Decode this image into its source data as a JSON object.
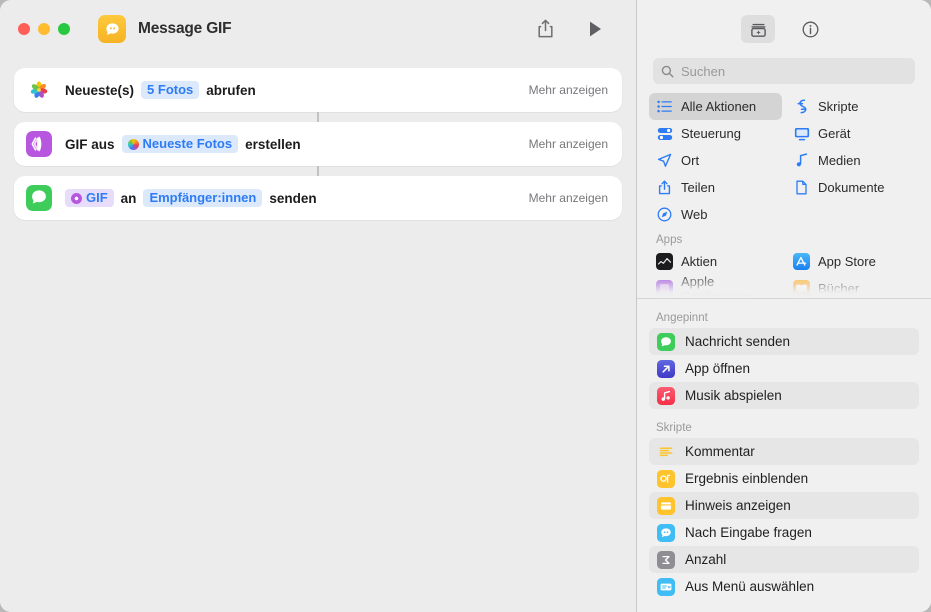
{
  "window": {
    "title": "Message GIF",
    "doc_icon": "messages-app-icon",
    "traffic_lights": [
      "close",
      "minimize",
      "zoom"
    ],
    "share_label": "share-icon",
    "run_label": "run-icon"
  },
  "editor": {
    "actions": [
      {
        "icon": "photos-app-icon",
        "more_label": "Mehr anzeigen",
        "parts": [
          {
            "type": "text",
            "value": "Neueste(s)"
          },
          {
            "type": "token",
            "value": "5 Fotos",
            "style": "blue"
          },
          {
            "type": "text",
            "value": "abrufen"
          }
        ]
      },
      {
        "icon": "gif-action-icon",
        "more_label": "Mehr anzeigen",
        "parts": [
          {
            "type": "text",
            "value": "GIF aus"
          },
          {
            "type": "token",
            "value": "Neueste Fotos",
            "style": "blue-dot"
          },
          {
            "type": "text",
            "value": "erstellen"
          }
        ]
      },
      {
        "icon": "messages-action-icon",
        "more_label": "Mehr anzeigen",
        "parts": [
          {
            "type": "token",
            "value": "GIF",
            "style": "purple-var"
          },
          {
            "type": "text",
            "value": "an"
          },
          {
            "type": "token",
            "value": "Empfänger:innen",
            "style": "blue"
          },
          {
            "type": "text",
            "value": "senden"
          }
        ]
      }
    ]
  },
  "library": {
    "toolbar": {
      "action_library_icon": "action-library-icon",
      "info_icon": "info-icon"
    },
    "search": {
      "placeholder": "Suchen",
      "value": "",
      "icon": "search-icon"
    },
    "categories": [
      {
        "label": "Alle Aktionen",
        "icon": "list-icon",
        "selected": true
      },
      {
        "label": "Skripte",
        "icon": "script-icon",
        "selected": false
      },
      {
        "label": "Steuerung",
        "icon": "controls-icon",
        "selected": false
      },
      {
        "label": "Gerät",
        "icon": "device-icon",
        "selected": false
      },
      {
        "label": "Ort",
        "icon": "location-icon",
        "selected": false
      },
      {
        "label": "Medien",
        "icon": "media-icon",
        "selected": false
      },
      {
        "label": "Teilen",
        "icon": "share-icon",
        "selected": false
      },
      {
        "label": "Dokumente",
        "icon": "document-icon",
        "selected": false
      },
      {
        "label": "Web",
        "icon": "web-icon",
        "selected": false
      }
    ],
    "apps_section": {
      "title": "Apps",
      "items": [
        {
          "label": "Aktien",
          "icon": "stocks-app-icon"
        },
        {
          "label": "App Store",
          "icon": "appstore-app-icon"
        },
        {
          "label": "Apple Configurator",
          "icon": "configurator-app-icon"
        },
        {
          "label": "Bücher",
          "icon": "books-app-icon"
        }
      ]
    },
    "pinned_section": {
      "title": "Angepinnt",
      "items": [
        {
          "label": "Nachricht senden",
          "icon": "messages-icon",
          "color": "#3ecc5a"
        },
        {
          "label": "App öffnen",
          "icon": "open-app-icon",
          "color": "#4f5bd5"
        },
        {
          "label": "Musik abspielen",
          "icon": "music-icon",
          "color": "#fa2d48"
        }
      ]
    },
    "scripts_section": {
      "title": "Skripte",
      "items": [
        {
          "label": "Kommentar",
          "icon": "comment-icon",
          "color": "#ffc32b"
        },
        {
          "label": "Ergebnis einblenden",
          "icon": "show-result-icon",
          "color": "#ffc32b"
        },
        {
          "label": "Hinweis anzeigen",
          "icon": "show-alert-icon",
          "color": "#ffc32b"
        },
        {
          "label": "Nach Eingabe fragen",
          "icon": "ask-input-icon",
          "color": "#40bdf5"
        },
        {
          "label": "Anzahl",
          "icon": "count-icon",
          "color": "#8e8e93"
        },
        {
          "label": "Aus Menü auswählen",
          "icon": "choose-menu-icon",
          "color": "#40bdf5"
        }
      ]
    }
  },
  "colors": {
    "accent_blue": "#2d7cf6",
    "token_bg": "#dbe9fb",
    "window_bg": "#ececec",
    "library_bg": "#f0f0f0",
    "card_bg": "#ffffff"
  }
}
